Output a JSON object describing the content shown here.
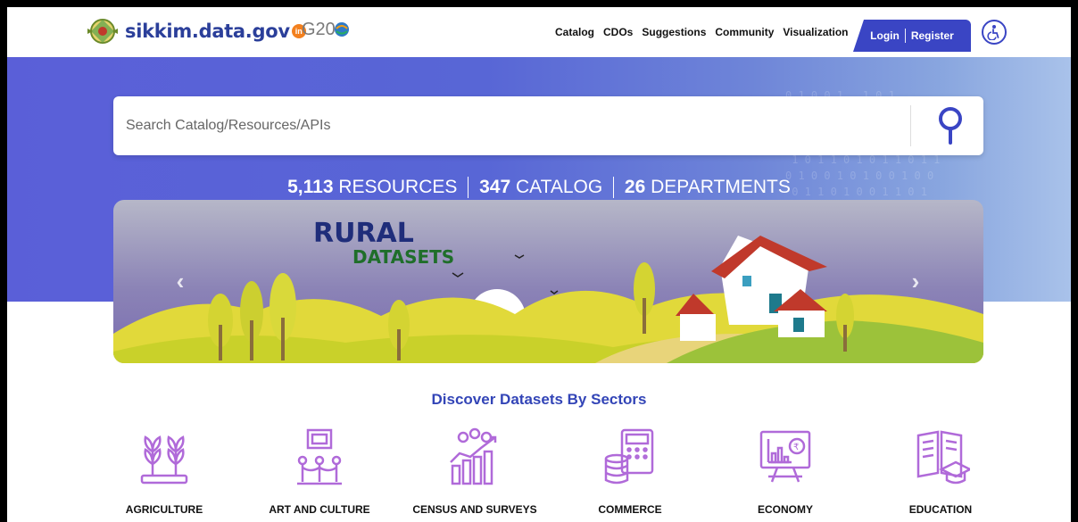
{
  "header": {
    "brand": "sikkim.data.gov",
    "brand_badge": "in",
    "g20": "G20",
    "nav": [
      "Catalog",
      "CDOs",
      "Suggestions",
      "Community",
      "Visualization"
    ],
    "login": "Login",
    "register": "Register"
  },
  "search": {
    "placeholder": "Search Catalog/Resources/APIs"
  },
  "stats": {
    "resources_count": "5,113",
    "resources_label": "RESOURCES",
    "catalog_count": "347",
    "catalog_label": "CATALOG",
    "departments_count": "26",
    "departments_label": "DEPARTMENTS"
  },
  "carousel": {
    "title": "RURAL",
    "subtitle": "DATASETS",
    "prev": "‹",
    "next": "›"
  },
  "sectors": {
    "title": "Discover Datasets By Sectors",
    "items": [
      {
        "label": "AGRICULTURE",
        "icon": "plant-icon"
      },
      {
        "label": "ART AND CULTURE",
        "icon": "art-icon"
      },
      {
        "label": "CENSUS AND SURVEYS",
        "icon": "census-icon"
      },
      {
        "label": "COMMERCE",
        "icon": "calculator-icon"
      },
      {
        "label": "ECONOMY",
        "icon": "economy-icon"
      },
      {
        "label": "EDUCATION",
        "icon": "education-icon"
      }
    ]
  },
  "colors": {
    "brand": "#2b3f9a",
    "accent": "#3a45c4",
    "sector_icon": "#b06ad9"
  }
}
